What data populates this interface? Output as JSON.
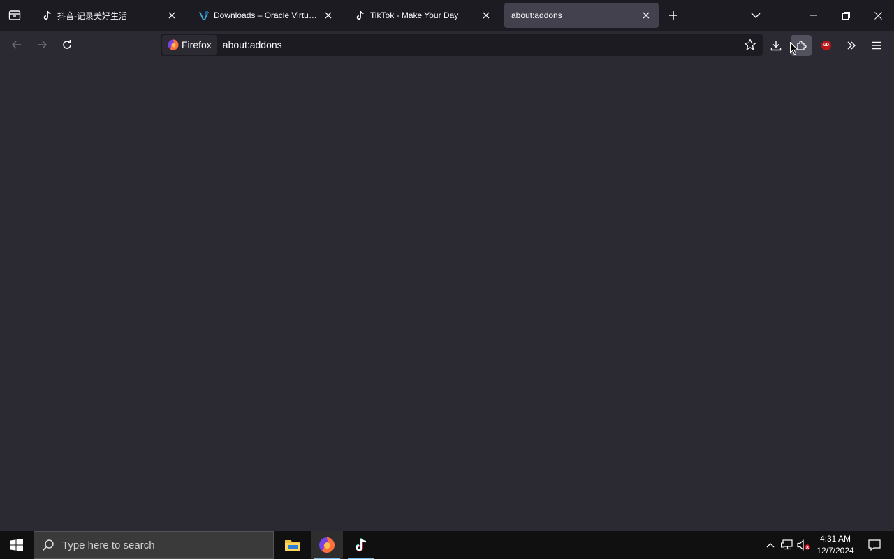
{
  "browser": {
    "tabs": [
      {
        "label": "抖音-记录美好生活",
        "icon": "tiktok-icon",
        "selected": false
      },
      {
        "label": "Downloads – Oracle VirtualBox",
        "icon": "virtualbox-icon",
        "selected": false
      },
      {
        "label": "TikTok - Make Your Day",
        "icon": "tiktok-icon",
        "selected": false
      },
      {
        "label": "about:addons",
        "icon": "none",
        "selected": true
      }
    ],
    "identity_label": "Firefox",
    "url": "about:addons",
    "toolbar_icons": [
      "back-icon",
      "forward-icon",
      "reload-icon",
      "bookmark-star-icon",
      "download-icon",
      "extensions-icon",
      "ublock-icon",
      "overflow-chevron-icon",
      "hamburger-menu-icon"
    ],
    "ublock_badge": "uD"
  },
  "taskbar": {
    "search_placeholder": "Type here to search",
    "apps": [
      "file-explorer-icon",
      "firefox-icon",
      "tiktok-icon"
    ],
    "time": "4:31 AM",
    "date": "12/7/2024"
  },
  "colors": {
    "chrome_bg": "#1c1b22",
    "toolbar_bg": "#2b2a33",
    "selected_tab": "#42414d",
    "taskbar_bg": "#101010",
    "accent": "#76b9ed"
  }
}
